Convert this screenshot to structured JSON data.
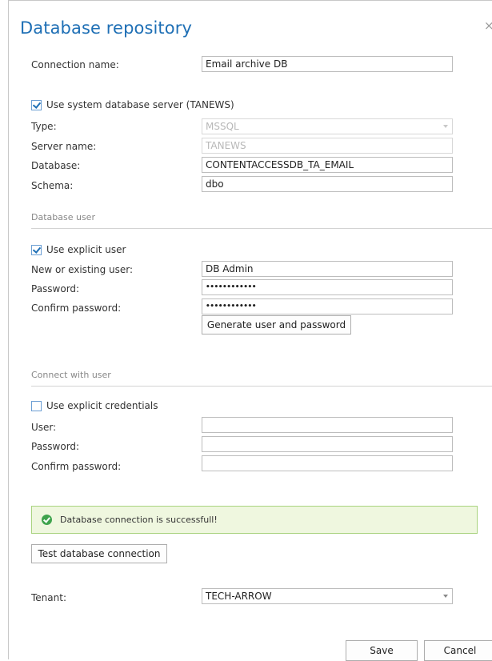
{
  "dialog": {
    "title": "Database repository",
    "close_label": "×"
  },
  "connection": {
    "name_label": "Connection name:",
    "name_value": "Email archive DB",
    "use_system_label": "Use system database server (TANEWS)",
    "use_system_checked": true,
    "type_label": "Type:",
    "type_value": "MSSQL",
    "server_label": "Server name:",
    "server_value": "TANEWS",
    "database_label": "Database:",
    "database_value": "CONTENTACCESSDB_TA_EMAIL",
    "schema_label": "Schema:",
    "schema_value": "dbo"
  },
  "database_user": {
    "section_title": "Database user",
    "explicit_user_label": "Use explicit user",
    "explicit_user_checked": true,
    "user_label": "New or existing user:",
    "user_value": "DB Admin",
    "password_label": "Password:",
    "password_value": "••••••••••••",
    "confirm_label": "Confirm password:",
    "confirm_value": "••••••••••••",
    "generate_button": "Generate user and password"
  },
  "connect_with_user": {
    "section_title": "Connect with user",
    "explicit_credentials_label": "Use explicit credentials",
    "explicit_credentials_checked": false,
    "user_label": "User:",
    "user_value": "",
    "password_label": "Password:",
    "password_value": "",
    "confirm_label": "Confirm password:",
    "confirm_value": ""
  },
  "status": {
    "message": "Database connection is successfull!",
    "color": "#3fa34d"
  },
  "test_button": "Test database connection",
  "tenant": {
    "label": "Tenant:",
    "value": "TECH-ARROW"
  },
  "footer": {
    "save_label": "Save",
    "cancel_label": "Cancel"
  },
  "colors": {
    "accent": "#1e6fb5",
    "success_bg": "#eff7df",
    "success_border": "#a9d37f"
  }
}
